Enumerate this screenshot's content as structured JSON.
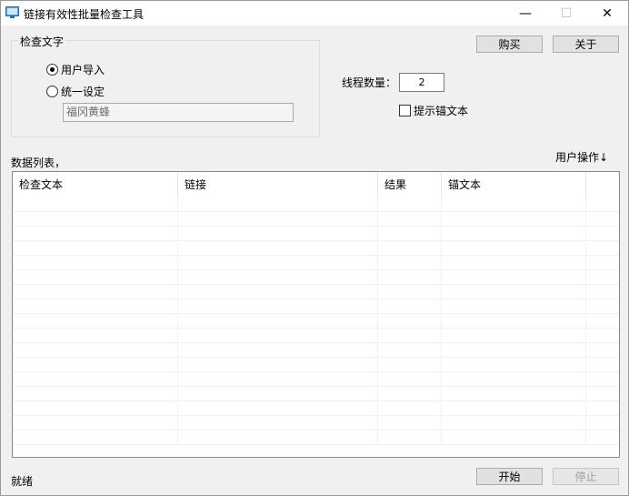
{
  "window": {
    "title": "链接有效性批量检查工具",
    "min_glyph": "—",
    "max_glyph": "☐",
    "close_glyph": "✕"
  },
  "group": {
    "legend": "检查文字",
    "radio_import_label": "用户导入",
    "radio_import_checked": true,
    "radio_uniform_label": "统一设定",
    "radio_uniform_checked": false,
    "uniform_value": "福冈黄蜂"
  },
  "buttons": {
    "buy": "购买",
    "about": "关于",
    "start": "开始",
    "stop": "停止"
  },
  "threads": {
    "label": "线程数量：",
    "value": "2"
  },
  "anchor_checkbox": {
    "label": "提示锚文本",
    "checked": false
  },
  "list": {
    "title": "数据列表，",
    "user_ops": "用户操作↓",
    "columns": [
      "检查文本",
      "链接",
      "结果",
      "锚文本",
      ""
    ]
  },
  "status": {
    "text": "就绪"
  },
  "icons": {
    "app": "app-window-icon"
  }
}
